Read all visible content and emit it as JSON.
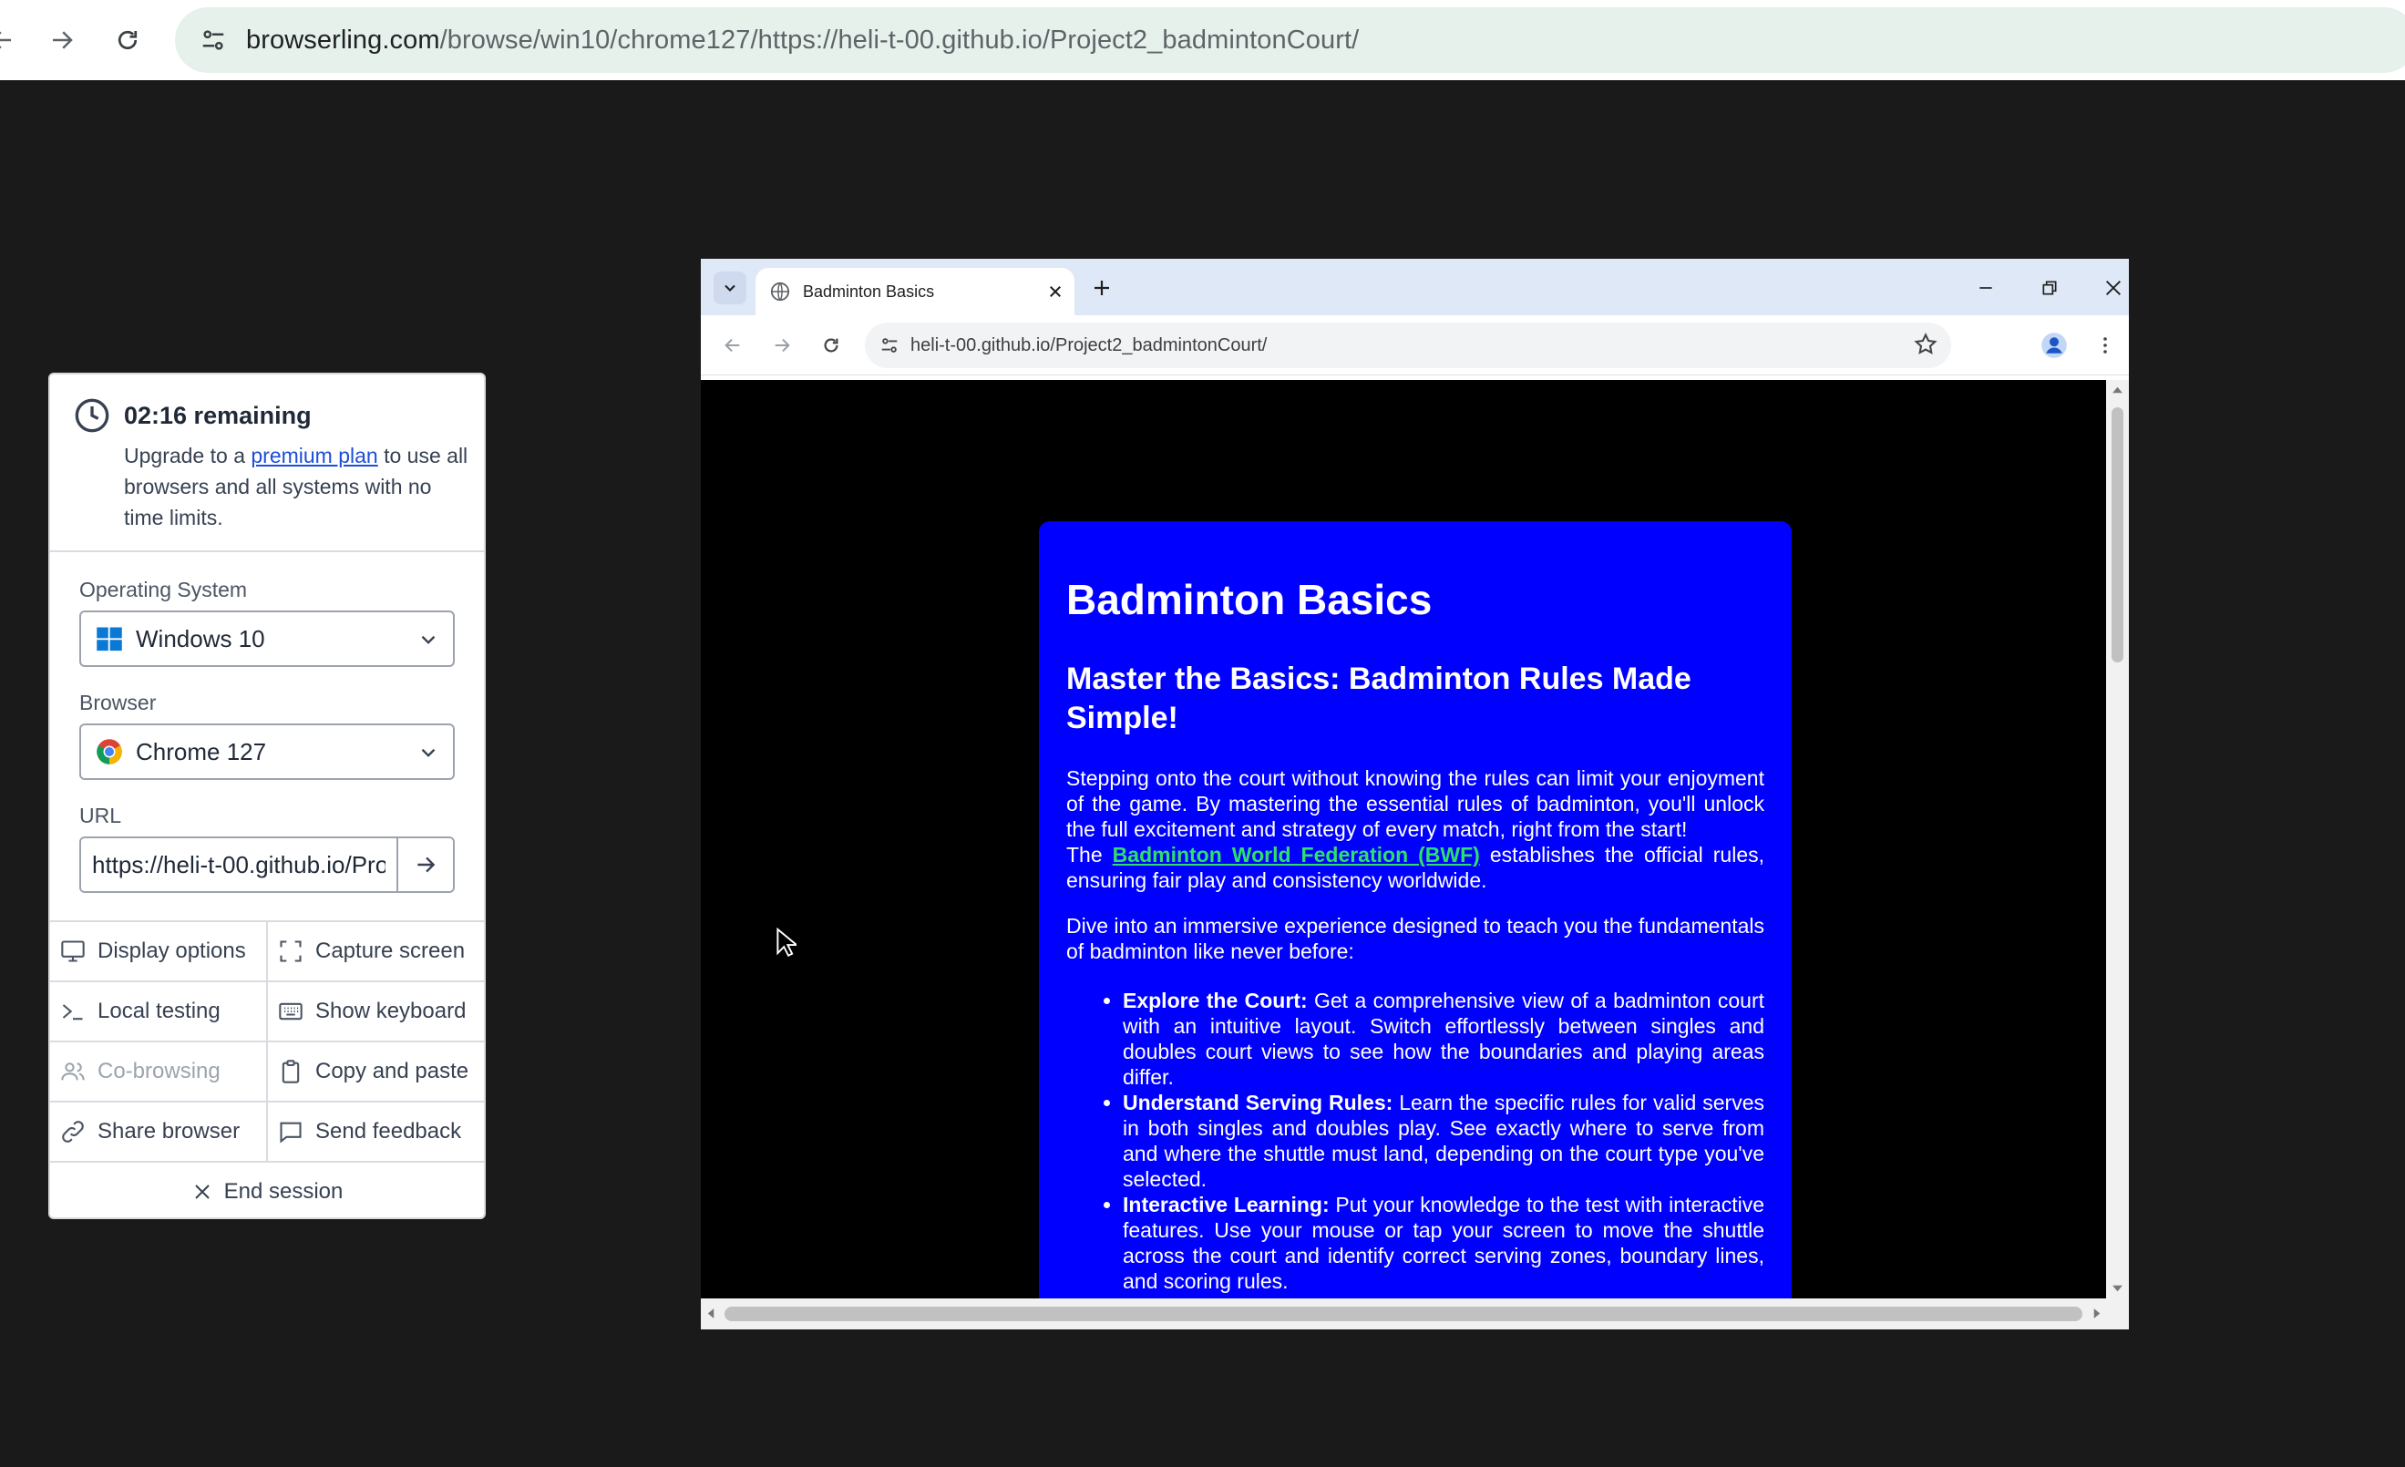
{
  "outer_browser": {
    "url_domain": "browserling.com",
    "url_rest": "/browse/win10/chrome127/https://heli-t-00.github.io/Project2_badmintonCourt/"
  },
  "panel": {
    "timer_title": "02:16 remaining",
    "upgrade_prefix": "Upgrade to a ",
    "upgrade_link": "premium plan",
    "upgrade_suffix": " to use all browsers and all systems with no time limits.",
    "os_label": "Operating System",
    "os_value": "Windows 10",
    "browser_label": "Browser",
    "browser_value": "Chrome 127",
    "url_label": "URL",
    "url_value": "https://heli-t-00.github.io/Project2_badmintonCourt/",
    "buttons": {
      "display_options": "Display options",
      "capture_screen": "Capture screen",
      "local_testing": "Local testing",
      "show_keyboard": "Show keyboard",
      "co_browsing": "Co-browsing",
      "copy_paste": "Copy and paste",
      "share_browser": "Share browser",
      "send_feedback": "Send feedback",
      "end_session": "End session"
    }
  },
  "remote": {
    "tab_title": "Badminton Basics",
    "url": "heli-t-00.github.io/Project2_badmintonCourt/"
  },
  "page": {
    "h1": "Badminton Basics",
    "h2": "Master the Basics: Badminton Rules Made Simple!",
    "p1": "Stepping onto the court without knowing the rules can limit your enjoyment of the game. By mastering the essential rules of badminton, you'll unlock the full excitement and strategy of every match, right from the start!",
    "p1b_prefix": "The ",
    "p1b_link": "Badminton World Federation (BWF)",
    "p1b_suffix": " establishes the official rules, ensuring fair play and consistency worldwide.",
    "p2": "Dive into an immersive experience designed to teach you the fundamentals of badminton like never before:",
    "bullets": [
      {
        "title": "Explore the Court:",
        "text": " Get a comprehensive view of a badminton court with an intuitive layout. Switch effortlessly between singles and doubles court views to see how the boundaries and playing areas differ."
      },
      {
        "title": "Understand Serving Rules:",
        "text": " Learn the specific rules for valid serves in both singles and doubles play. See exactly where to serve from and where the shuttle must land, depending on the court type you've selected."
      },
      {
        "title": "Interactive Learning:",
        "text": " Put your knowledge to the test with interactive features. Use your mouse or tap your screen to move the shuttle across the court and identify correct serving zones, boundary lines, and scoring rules."
      }
    ]
  }
}
